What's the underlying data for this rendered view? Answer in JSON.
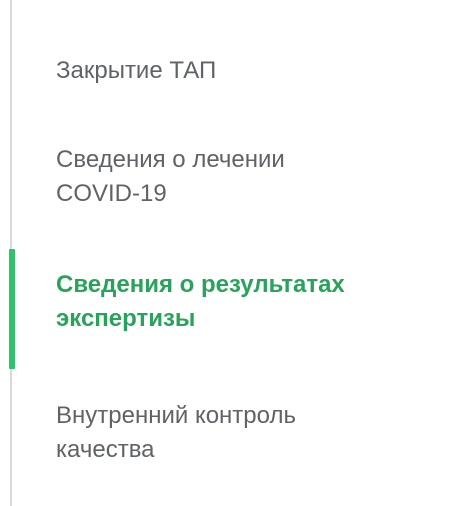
{
  "sidebar": {
    "accent_color": "#2ec26a",
    "active_index": 2,
    "items": [
      {
        "lines": [
          "Закрытие ТАП"
        ]
      },
      {
        "lines": [
          "Сведения о лечении",
          "COVID-19"
        ]
      },
      {
        "lines": [
          "Сведения о результатах",
          "экспертизы"
        ]
      },
      {
        "lines": [
          "Внутренний контроль",
          "качества"
        ]
      }
    ]
  }
}
